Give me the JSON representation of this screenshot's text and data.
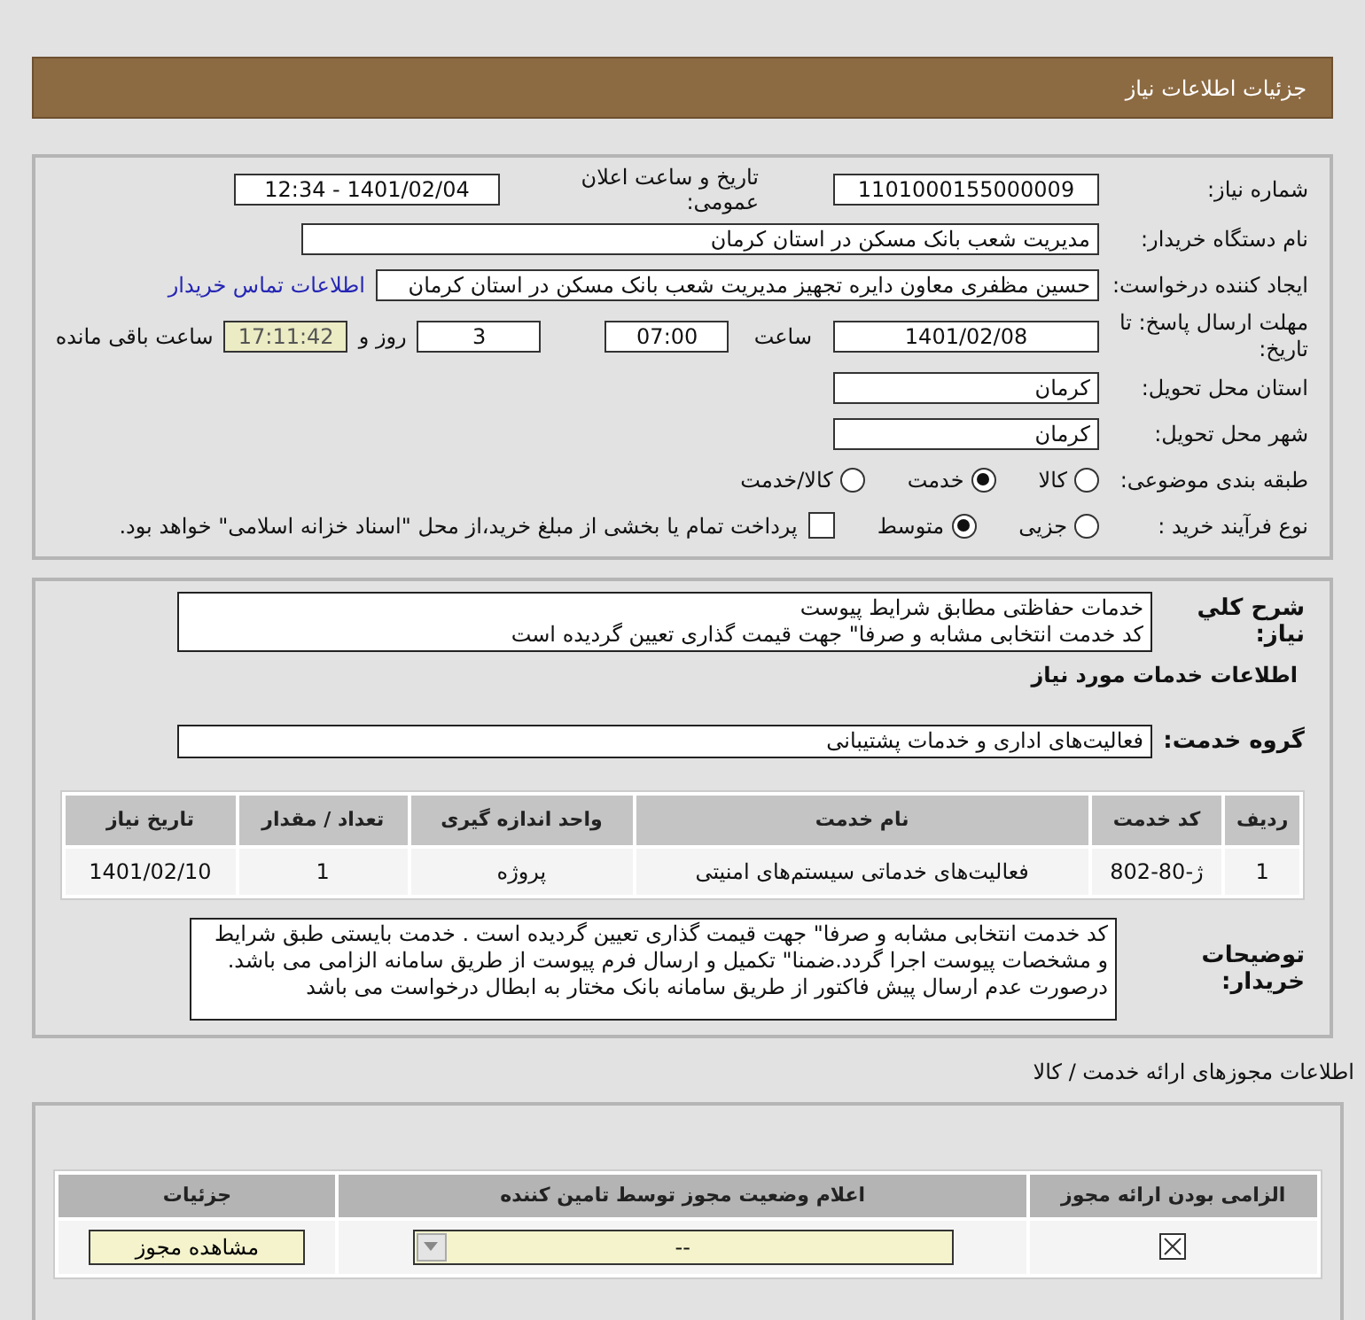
{
  "title": "جزئیات اطلاعات نیاز",
  "need_number": {
    "label": "شماره نیاز:",
    "value": "1101000155000009"
  },
  "announce": {
    "label": "تاریخ و ساعت اعلان عمومی:",
    "value": "1401/02/04 - 12:34"
  },
  "buyer": {
    "label": "نام دستگاه خریدار:",
    "value": "مدیریت شعب بانک مسکن در استان کرمان"
  },
  "creator": {
    "label": "ایجاد کننده درخواست:",
    "value": "حسین  مظفری  معاون دایره تجهیز مدیریت شعب بانک مسکن در استان کرمان",
    "link": "اطلاعات تماس خریدار"
  },
  "deadline": {
    "label": "مهلت ارسال پاسخ: تا تاریخ:",
    "date": "1401/02/08",
    "time_label": "ساعت",
    "time": "07:00",
    "days": "3",
    "days_label": "روز و",
    "remaining": "17:11:42",
    "remaining_label": "ساعت باقی مانده"
  },
  "province": {
    "label": "استان محل تحویل:",
    "value": "کرمان"
  },
  "city": {
    "label": "شهر محل تحویل:",
    "value": "کرمان"
  },
  "category": {
    "label": "طبقه بندی موضوعی:",
    "options": [
      {
        "label": "کالا",
        "selected": false
      },
      {
        "label": "خدمت",
        "selected": true
      },
      {
        "label": "کالا/خدمت",
        "selected": false
      }
    ]
  },
  "purchase": {
    "label": "نوع فرآیند خرید :",
    "options": [
      {
        "label": "جزیی",
        "selected": false
      },
      {
        "label": "متوسط",
        "selected": true
      }
    ],
    "payment": {
      "label": "پرداخت تمام یا بخشی از مبلغ خرید،از محل \"اسناد خزانه اسلامی\" خواهد بود.",
      "checked": false
    }
  },
  "description": {
    "label": "شرح کلي نياز:",
    "lines": [
      "خدمات حفاظتی مطابق شرایط پیوست",
      "کد خدمت انتخابی مشابه و صرفا\" جهت قیمت گذاری تعیین گردیده است"
    ]
  },
  "services_title": "اطلاعات خدمات مورد نیاز",
  "service_group": {
    "label": "گروه خدمت:",
    "value": "فعالیت‌های اداری و خدمات پشتیبانی"
  },
  "table": {
    "columns": [
      "ردیف",
      "کد خدمت",
      "نام خدمت",
      "واحد اندازه گیری",
      "تعداد / مقدار",
      "تاریخ نیاز"
    ],
    "rows": [
      [
        "1",
        "ژ-80-802",
        "فعالیت‌های خدماتی سیستم‌های امنیتی",
        "پروژه",
        "1",
        "1401/02/10"
      ]
    ]
  },
  "buyer_notes": {
    "label": "توضیحات خریدار:",
    "lines": [
      "کد خدمت انتخابی مشابه و صرفا\" جهت قیمت گذاری تعیین گردیده است . خدمت بایستی طبق شرایط",
      "و مشخصات پیوست اجرا گردد.ضمنا\" تکمیل و ارسال فرم پیوست از طریق سامانه الزامی می باشد.",
      "درصورت عدم ارسال پیش فاکتور از طریق سامانه بانک مختار به ابطال درخواست می باشد"
    ]
  },
  "permits": {
    "title": "اطلاعات مجوزهای ارائه خدمت / کالا",
    "columns": [
      "الزامی بودن ارائه مجوز",
      "اعلام وضعیت مجوز توسط تامین کننده",
      "جزئیات"
    ],
    "rows": [
      {
        "required": true,
        "status": "--",
        "button": "مشاهده مجوز"
      }
    ]
  }
}
